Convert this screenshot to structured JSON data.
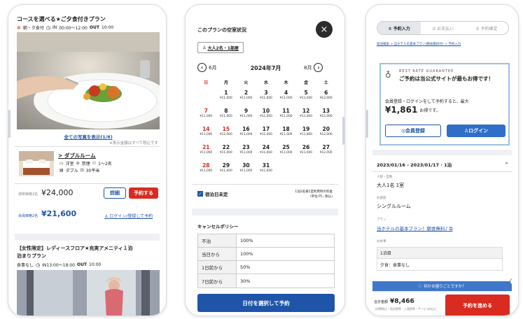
{
  "left": {
    "plan1_title": "コースを選べる★ご夕食付きプラン",
    "plan1_meals": "朝・夕食付",
    "plan1_checkin_prefix": "IN",
    "plan1_checkin_range": "00:00〜12:00",
    "plan1_out_label": "OUT",
    "plan1_out_time": "10:00",
    "all_photos_link": "全ての写真を表示(1/8)",
    "photo_note": "※表示金額はすべて税込です",
    "room_name": "ダブルルーム",
    "room_spec1": "洋室",
    "room_spec2": "禁煙",
    "room_spec3": "1〜2名",
    "room_spec4": "ダブル",
    "room_spec5": "30平米",
    "regular_label": "通常価格2名",
    "regular_price": "¥24,000",
    "detail_button": "詳細",
    "reserve_button": "予約する",
    "member_label": "会員価格2名",
    "member_price": "¥21,600",
    "login_link": "ログイン/登録して予約",
    "plan2_title": "【女性限定】レディースフロア★充実アメニティ１泊",
    "plan2_title2": "泊まりプラン",
    "plan2_meals": "食事なし",
    "plan2_checkin": "IN13:00〜18:00",
    "plan2_out_label": "OUT",
    "plan2_out_time": "10:00"
  },
  "middle": {
    "heading": "このプランの空室状況",
    "guest_selector": "大人2名・1部屋",
    "prev_month": "6月",
    "current_month": "2024年7月",
    "next_month": "8月",
    "weekdays": [
      "日",
      "月",
      "火",
      "水",
      "木",
      "金",
      "土"
    ],
    "calendar": [
      [
        "",
        "",
        "",
        "",
        "",
        "",
        ""
      ],
      [
        "",
        "1",
        "2",
        "3",
        "4",
        "5",
        "6"
      ],
      [
        "7",
        "8",
        "9",
        "10",
        "11",
        "12",
        "13"
      ],
      [
        "14",
        "15",
        "16",
        "17",
        "18",
        "19",
        "20"
      ],
      [
        "21",
        "22",
        "23",
        "24",
        "25",
        "26",
        "27"
      ],
      [
        "28",
        "29",
        "30",
        "31",
        "",
        "",
        ""
      ]
    ],
    "prices": [
      [
        "",
        "",
        "",
        "",
        "",
        "",
        ""
      ],
      [
        "",
        "¥11,000",
        "¥11,000",
        "¥11,000",
        "¥11,000",
        "¥11,000",
        "¥12,000"
      ],
      [
        "¥11,000",
        "¥11,000",
        "¥11,000",
        "¥11,000",
        "¥11,000",
        "¥11,000",
        "¥12,000"
      ],
      [
        "¥11,000",
        "¥11,000",
        "¥11,000",
        "¥11,000",
        "¥11,000",
        "¥11,000",
        "¥12,000"
      ],
      [
        "¥11,000",
        "¥11,000",
        "¥11,000",
        "¥11,000",
        "¥11,000",
        "¥11,000",
        "¥12,000"
      ],
      [
        "¥11,000",
        "¥11,000",
        "¥11,000",
        "¥11,000",
        "",
        "",
        ""
      ]
    ],
    "red_days": [
      "7",
      "14",
      "15",
      "21",
      "28"
    ],
    "undecided_label": "宿泊日未定",
    "price_note1": "1泊2名様1室利用時の料金",
    "price_note2": "(単位:円・税込)",
    "cancel_heading": "キャンセルポリシー",
    "cancel_rows": [
      {
        "when": "不泊",
        "rate": "100%"
      },
      {
        "when": "当日から",
        "rate": "100%"
      },
      {
        "when": "1日前から",
        "rate": "50%"
      },
      {
        "when": "7日前から",
        "rate": "30%"
      }
    ],
    "cta": "日付を選択して予約"
  },
  "right": {
    "steps": [
      "① 予約入力",
      "② お支払い",
      "③ 予約確定"
    ],
    "breadcrumb": "宿泊検索 > 当ホテルの基本プラン(朝食無料付) > 予約入力",
    "brg_title": "BEST RATE GUARANTEE",
    "brg_text": "ご予約は当公式サイトが最もお得です！",
    "member_text": "会員登録・ログインをして予約すると、最大",
    "discount_amount": "¥1,861",
    "discount_suffix": "お得です。",
    "register_button": "会員登録",
    "login_button": "ログイン",
    "date_range": "2023/01/16 - 2023/01/17 · 1泊",
    "guests_label": "人数・室数",
    "guests_value": "大人1名 1室",
    "room_label": "お部屋",
    "room_value": "シングルルーム",
    "plan_label": "プラン",
    "plan_link": "当ホテルの基本プラン！朝食無料♪",
    "meal_label": "お食事",
    "meal_day": "1泊目",
    "meal_value": "夕食：食事なし",
    "help_bar": "何かお困りごとですか？",
    "total_label": "合計金額",
    "total_amount": "¥8,466",
    "total_note": "(消費税込・宿泊税等・入湯税等・サービス料込)",
    "proceed_button": "予約を進める"
  },
  "colors": {
    "red": "#d92b1f",
    "blue": "#1f55a8",
    "blue_bar": "#2f6fc7"
  }
}
